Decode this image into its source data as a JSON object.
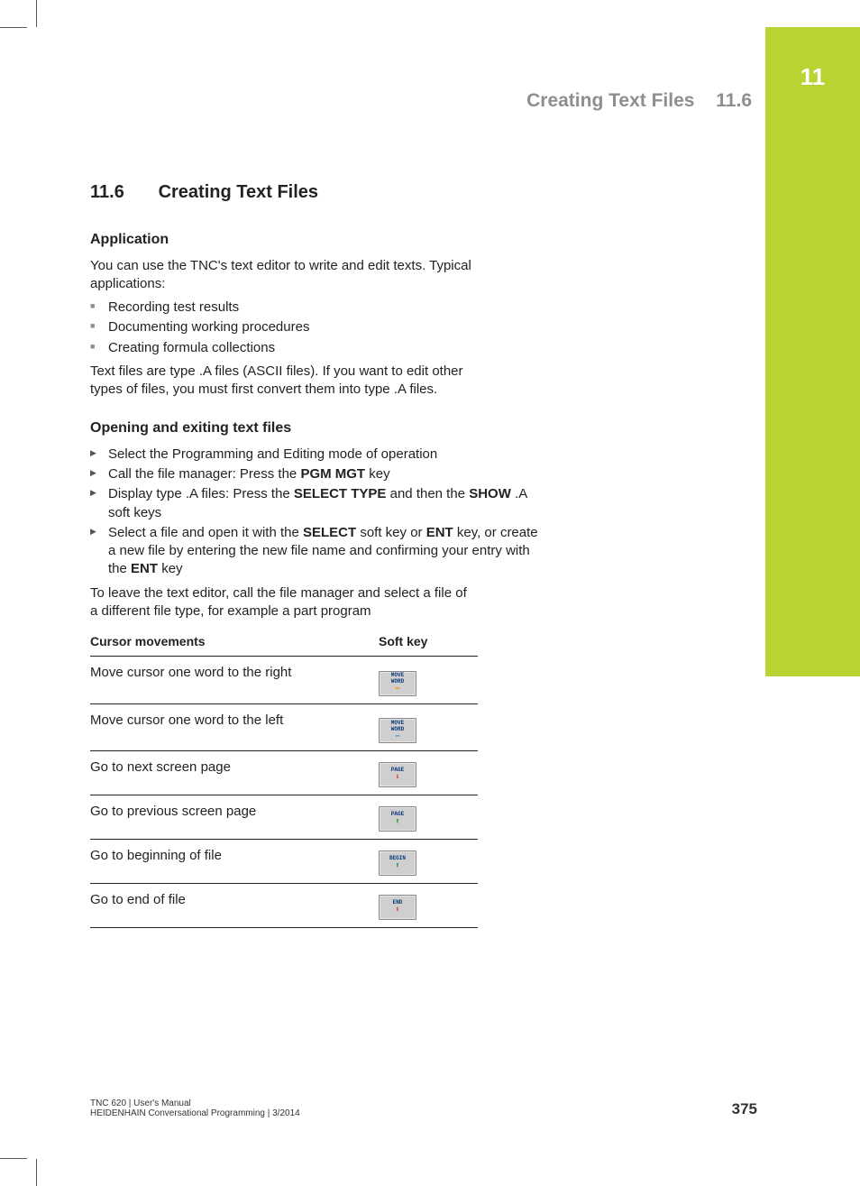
{
  "chapter_number": "11",
  "header": {
    "title": "Creating Text Files",
    "section": "11.6"
  },
  "section": {
    "number": "11.6",
    "title": "Creating Text Files"
  },
  "application": {
    "heading": "Application",
    "intro": "You can use the TNC's text editor to write and edit texts. Typical applications:",
    "bullets": [
      "Recording test results",
      "Documenting working procedures",
      "Creating formula collections"
    ],
    "outro": "Text files are type .A files (ASCII files). If you want to edit other types of files, you must first convert them into type .A files."
  },
  "opening": {
    "heading": "Opening and exiting text files",
    "steps": [
      {
        "text": "Select the Programming and Editing mode of operation"
      },
      {
        "pre": "Call the file manager: Press the ",
        "b1": "PGM MGT",
        "post": " key"
      },
      {
        "pre": "Display type .A files: Press the ",
        "b1": "SELECT TYPE",
        "mid": " and then the ",
        "b2": "SHOW",
        "post": " .A soft keys"
      },
      {
        "pre": "Select a file and open it with the ",
        "b1": "SELECT",
        "mid": " soft key or ",
        "b2": "ENT",
        "mid2": " key, or create a new file by entering the new file name and confirming your entry with the ",
        "b3": "ENT",
        "post": " key"
      }
    ],
    "outro": "To leave the text editor, call the file manager and select a file of a different file type, for example a part program"
  },
  "table": {
    "col1": "Cursor movements",
    "col2": "Soft key",
    "rows": [
      {
        "desc": "Move cursor one word to the right",
        "label": "MOVE\nWORD",
        "arrow": "right"
      },
      {
        "desc": "Move cursor one word to the left",
        "label": "MOVE\nWORD",
        "arrow": "left"
      },
      {
        "desc": "Go to next screen page",
        "label": "PAGE",
        "arrow": "down"
      },
      {
        "desc": "Go to previous screen page",
        "label": "PAGE",
        "arrow": "up"
      },
      {
        "desc": "Go to beginning of file",
        "label": "BEGIN",
        "arrow": "up"
      },
      {
        "desc": "Go to end of file",
        "label": "END",
        "arrow": "down"
      }
    ]
  },
  "footer": {
    "line1": "TNC 620 | User's Manual",
    "line2": "HEIDENHAIN Conversational Programming | 3/2014",
    "page": "375"
  }
}
